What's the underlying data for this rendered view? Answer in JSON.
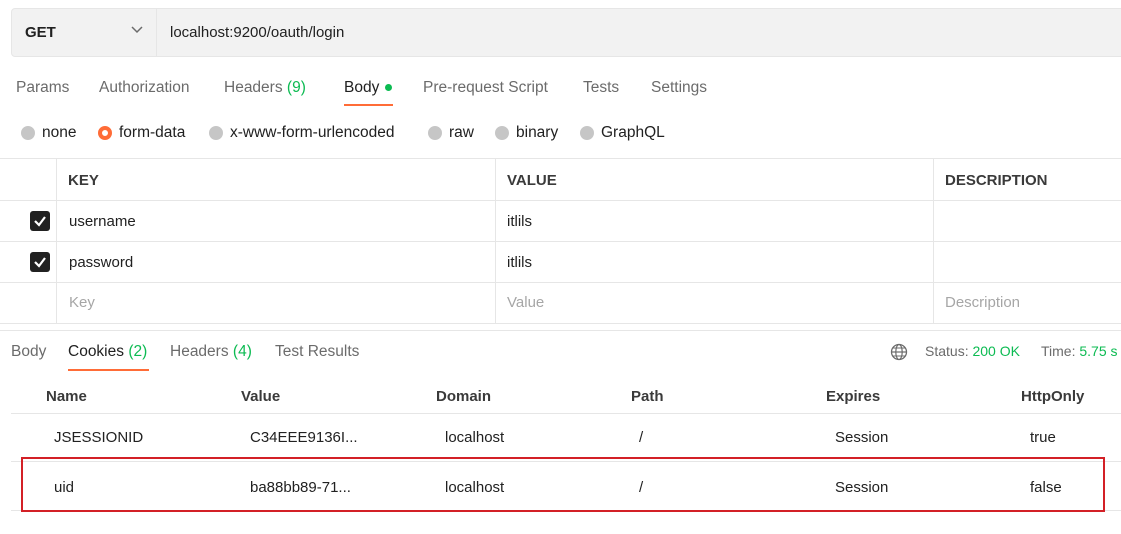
{
  "request": {
    "method": "GET",
    "url": "localhost:9200/oauth/login"
  },
  "request_tabs": [
    {
      "label": "Params",
      "count": ""
    },
    {
      "label": "Authorization",
      "count": ""
    },
    {
      "label": "Headers ",
      "count": "(9)"
    },
    {
      "label": "Body",
      "count": ""
    },
    {
      "label": "Pre-request Script",
      "count": ""
    },
    {
      "label": "Tests",
      "count": ""
    },
    {
      "label": "Settings",
      "count": ""
    }
  ],
  "body_types": [
    {
      "label": "none",
      "selected": false
    },
    {
      "label": "form-data",
      "selected": true
    },
    {
      "label": "x-www-form-urlencoded",
      "selected": false
    },
    {
      "label": "raw",
      "selected": false
    },
    {
      "label": "binary",
      "selected": false
    },
    {
      "label": "GraphQL",
      "selected": false
    }
  ],
  "params_table": {
    "headers": [
      "KEY",
      "VALUE",
      "DESCRIPTION"
    ],
    "rows": [
      {
        "key": "username",
        "value": "itlils",
        "checked": true
      },
      {
        "key": "password",
        "value": "itlils",
        "checked": true
      }
    ],
    "placeholders": {
      "key": "Key",
      "value": "Value",
      "description": "Description"
    }
  },
  "response_tabs": [
    {
      "label": "Body",
      "count": ""
    },
    {
      "label": "Cookies ",
      "count": "(2)"
    },
    {
      "label": "Headers ",
      "count": "(4)"
    },
    {
      "label": "Test Results",
      "count": ""
    }
  ],
  "status": {
    "status_label": "Status:",
    "status_value": "200 OK",
    "time_label": "Time:",
    "time_value": "5.75 s"
  },
  "cookies_table": {
    "headers": [
      "Name",
      "Value",
      "Domain",
      "Path",
      "Expires",
      "HttpOnly"
    ],
    "rows": [
      {
        "name": "JSESSIONID",
        "value": "C34EEE9136I...",
        "domain": "localhost",
        "path": "/",
        "expires": "Session",
        "httponly": "true"
      },
      {
        "name": "uid",
        "value": "ba88bb89-71...",
        "domain": "localhost",
        "path": "/",
        "expires": "Session",
        "httponly": "false"
      }
    ]
  },
  "colors": {
    "accent": "#ff6c37",
    "count": "#0cbb52",
    "highlight": "#d32026"
  }
}
